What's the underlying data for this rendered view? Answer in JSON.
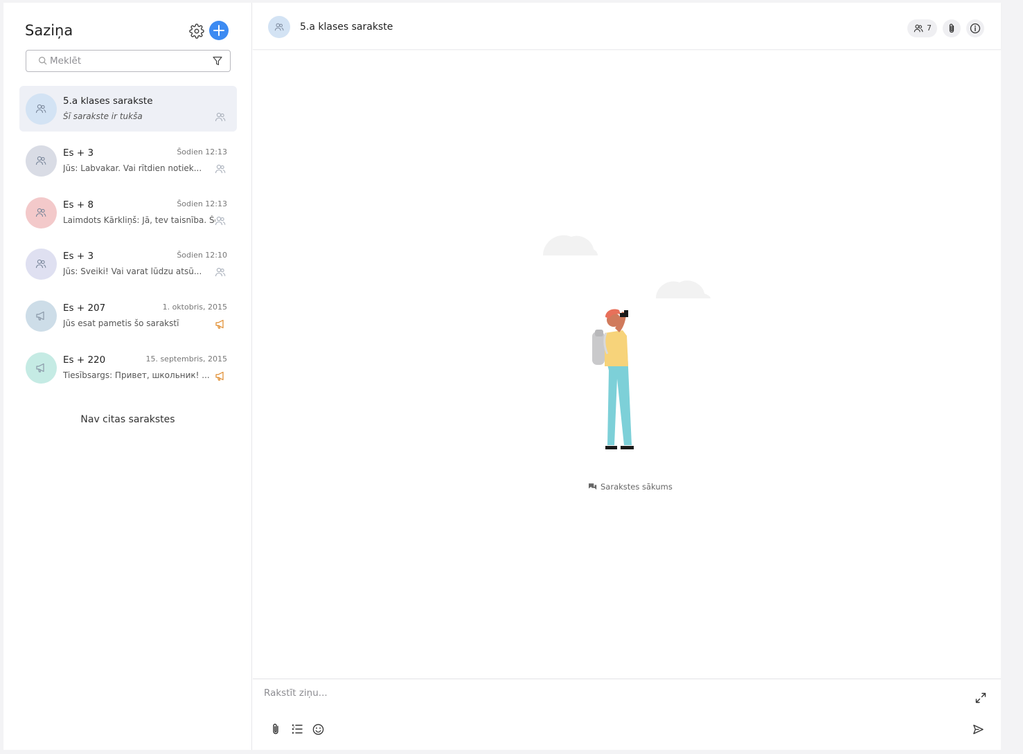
{
  "sidebar": {
    "title": "Saziņa",
    "search_placeholder": "Meklēt",
    "conversations": [
      {
        "name": "5.a klases sarakste",
        "time": "",
        "preview": "Šī sarakste ir tukša",
        "type": "group-icon",
        "avatar_color": "#d3e3f4",
        "active": true
      },
      {
        "name": "Es + 3",
        "time": "Šodien 12:13",
        "preview": "Jūs: Labvakar. Vai rītdien notiek...",
        "type": "group-icon",
        "avatar_color": "#d9dce5",
        "active": false
      },
      {
        "name": "Es + 8",
        "time": "Šodien 12:13",
        "preview": "Laimdots Kārkliņš: Jā, tev taisnība. Šodien",
        "type": "group-icon",
        "avatar_color": "#f3c9ca",
        "active": false
      },
      {
        "name": "Es + 3",
        "time": "Šodien 12:10",
        "preview": "Jūs: Sveiki! Vai varat lūdzu atsū...",
        "type": "group-icon",
        "avatar_color": "#dfe0f1",
        "active": false
      },
      {
        "name": "Es + 207",
        "time": "1. oktobris, 2015",
        "preview": "Jūs esat pametis šo sarakstī",
        "type": "megaphone-icon",
        "avatar_color": "#cddde8",
        "active": false
      },
      {
        "name": "Es + 220",
        "time": "15. septembris, 2015",
        "preview": "Tiesībsargs: Привет, школьник! ...",
        "type": "megaphone-icon",
        "avatar_color": "#c5ebe4",
        "active": false
      }
    ],
    "no_more_text": "Nav citas sarakstes"
  },
  "chat": {
    "title": "5.a klases sarakste",
    "member_count": "7",
    "start_label": "Sarakstes sākums"
  },
  "composer": {
    "placeholder": "Rakstīt ziņu..."
  },
  "colors": {
    "accent": "#3d8bf2",
    "announcement": "#e08a2a"
  }
}
